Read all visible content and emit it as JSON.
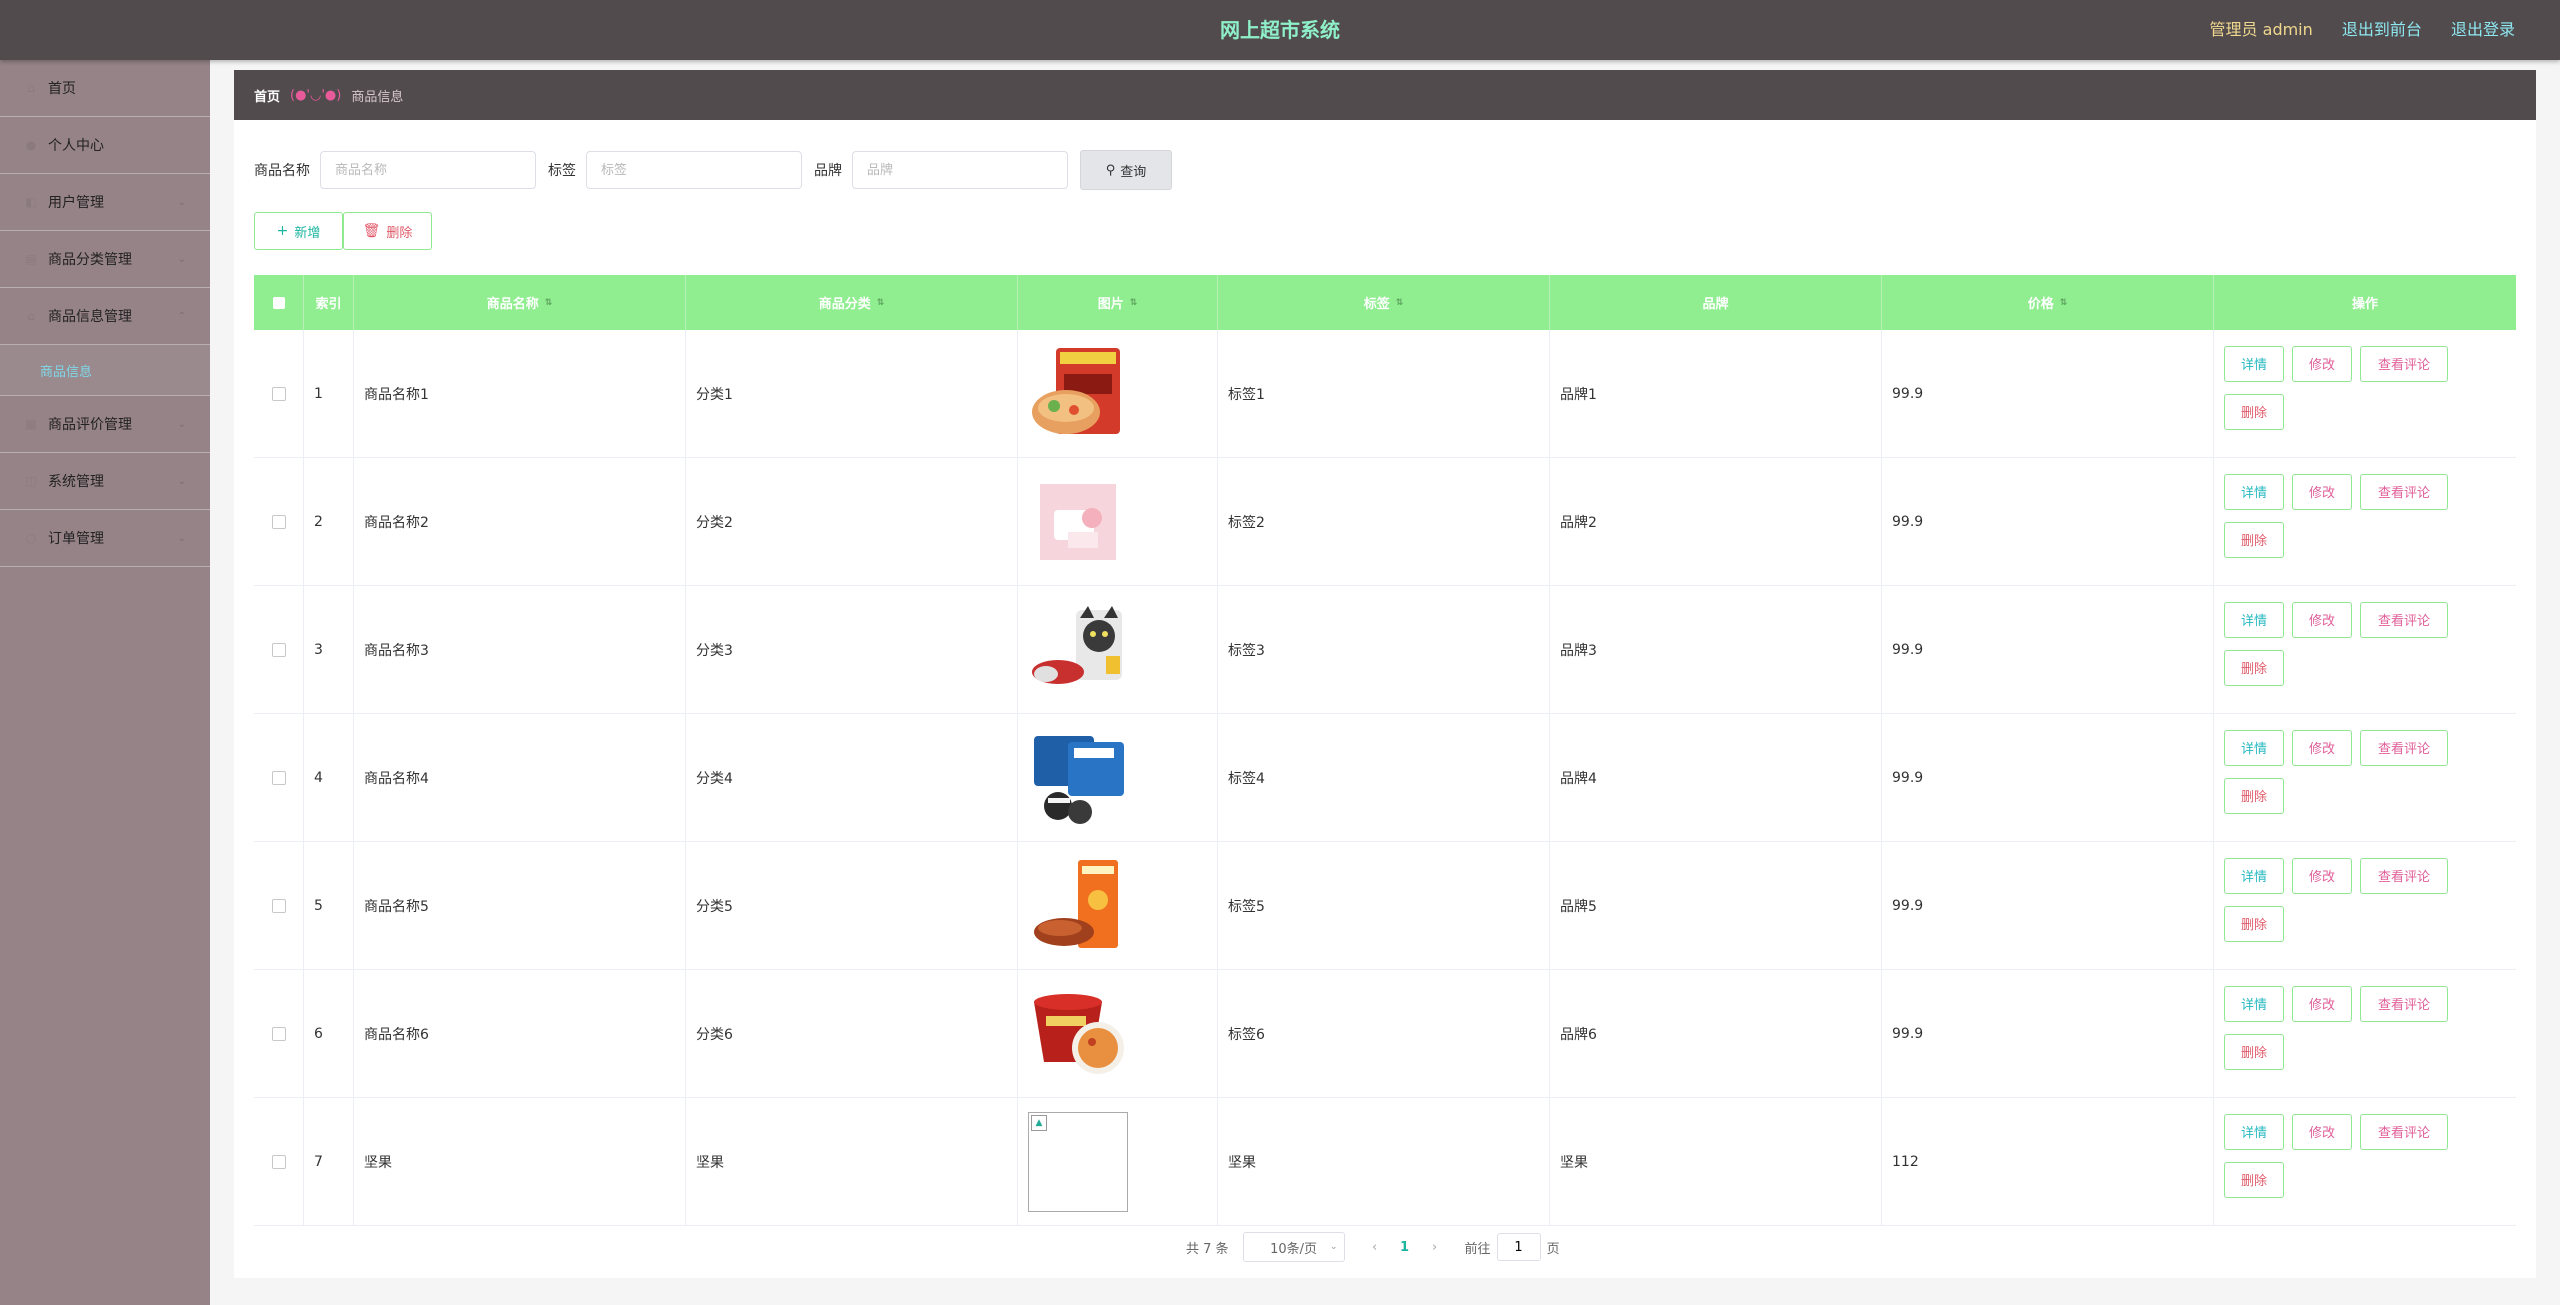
{
  "header": {
    "title": "网上超市系统",
    "admin": "管理员 admin",
    "front_link": "退出到前台",
    "logout_link": "退出登录"
  },
  "sidebar": {
    "items": [
      {
        "label": "首页",
        "icon": "home-icon"
      },
      {
        "label": "个人中心",
        "icon": "user-icon"
      },
      {
        "label": "用户管理",
        "icon": "users-icon"
      },
      {
        "label": "商品分类管理",
        "icon": "category-icon"
      },
      {
        "label": "商品信息管理",
        "icon": "goods-icon"
      },
      {
        "label": "商品评价管理",
        "icon": "comment-icon"
      },
      {
        "label": "系统管理",
        "icon": "settings-icon"
      },
      {
        "label": "订单管理",
        "icon": "order-icon"
      }
    ],
    "submenu": "商品信息"
  },
  "breadcrumb": {
    "home": "首页",
    "separator": "(●'◡'●)",
    "current": "商品信息"
  },
  "search": {
    "name_label": "商品名称",
    "name_placeholder": "商品名称",
    "tag_label": "标签",
    "tag_placeholder": "标签",
    "brand_label": "品牌",
    "brand_placeholder": "品牌",
    "button": "查询"
  },
  "actions": {
    "add": "新增",
    "delete": "删除"
  },
  "table": {
    "headers": {
      "index": "索引",
      "name": "商品名称",
      "category": "商品分类",
      "image": "图片",
      "tag": "标签",
      "brand": "品牌",
      "price": "价格",
      "ops": "操作"
    },
    "rows": [
      {
        "index": "1",
        "name": "商品名称1",
        "category": "分类1",
        "tag": "标签1",
        "brand": "品牌1",
        "price": "99.9"
      },
      {
        "index": "2",
        "name": "商品名称2",
        "category": "分类2",
        "tag": "标签2",
        "brand": "品牌2",
        "price": "99.9"
      },
      {
        "index": "3",
        "name": "商品名称3",
        "category": "分类3",
        "tag": "标签3",
        "brand": "品牌3",
        "price": "99.9"
      },
      {
        "index": "4",
        "name": "商品名称4",
        "category": "分类4",
        "tag": "标签4",
        "brand": "品牌4",
        "price": "99.9"
      },
      {
        "index": "5",
        "name": "商品名称5",
        "category": "分类5",
        "tag": "标签5",
        "brand": "品牌5",
        "price": "99.9"
      },
      {
        "index": "6",
        "name": "商品名称6",
        "category": "分类6",
        "tag": "标签6",
        "brand": "品牌6",
        "price": "99.9"
      },
      {
        "index": "7",
        "name": "坚果",
        "category": "坚果",
        "tag": "坚果",
        "brand": "坚果",
        "price": "112"
      }
    ],
    "ops": {
      "detail": "详情",
      "edit": "修改",
      "review": "查看评论",
      "delete": "删除"
    }
  },
  "pagination": {
    "total": "共 7 条",
    "page_size": "10条/页",
    "current": "1",
    "goto_label": "前往",
    "goto_value": "1",
    "page_suffix": "页"
  },
  "colors": {
    "topbar": "#514b4e",
    "sidebar": "#968388",
    "table_header": "#90ee90",
    "title": "#8ef0c8",
    "accent": "#1bb5a0"
  }
}
